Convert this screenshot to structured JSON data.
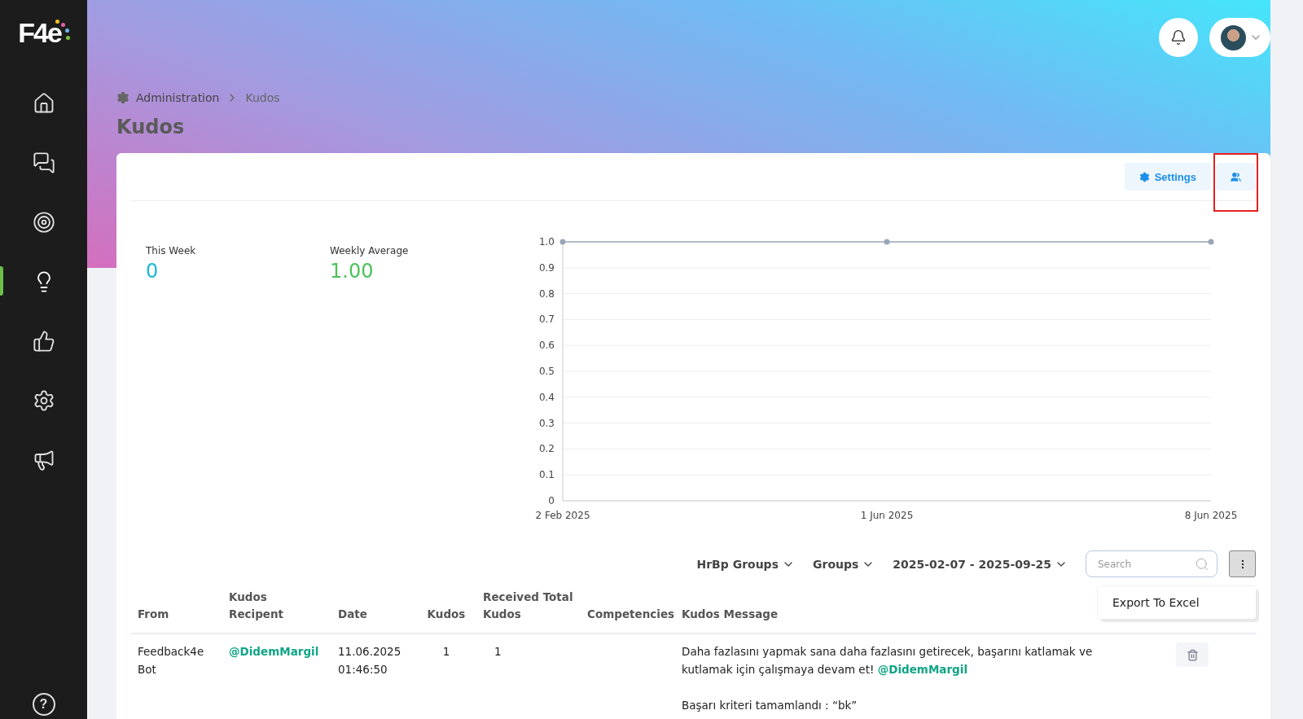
{
  "sidebar": {
    "logo": "F4e",
    "items": [
      {
        "kind": "home",
        "selected": false
      },
      {
        "kind": "chat",
        "selected": false
      },
      {
        "kind": "target",
        "selected": false
      },
      {
        "kind": "idea",
        "selected": true
      },
      {
        "kind": "thumb",
        "selected": false
      },
      {
        "kind": "gear",
        "selected": false
      },
      {
        "kind": "megaphone",
        "selected": false
      }
    ],
    "help": "?"
  },
  "header": {
    "breadcrumb": [
      "Administration",
      "Kudos"
    ],
    "title": "Kudos"
  },
  "toolbar": {
    "buttons": [
      {
        "kind": "settings",
        "label": "Settings"
      },
      {
        "kind": "groups",
        "highlighted": true
      }
    ]
  },
  "stats": [
    {
      "label": "This Week",
      "value": "0",
      "color": "#1ab8d6"
    },
    {
      "label": "Weekly Average",
      "value": "1.00",
      "color": "#4cc25a"
    }
  ],
  "chart_data": {
    "type": "line",
    "grid": true,
    "categories": [
      "2 Feb 2025",
      "1 Jun 2025",
      "8 Jun 2025"
    ],
    "series": [
      {
        "color": "#9aa6b8",
        "marker": true,
        "values": [
          1,
          1,
          1
        ]
      }
    ],
    "ylim": [
      0,
      1
    ],
    "yticks": [
      {
        "value": 0,
        "label": "0"
      },
      {
        "value": 0.1,
        "label": "0.1"
      },
      {
        "value": 0.2,
        "label": "0.2"
      },
      {
        "value": 0.3,
        "label": "0.3"
      },
      {
        "value": 0.4,
        "label": "0.4"
      },
      {
        "value": 0.5,
        "label": "0.5"
      },
      {
        "value": 0.6,
        "label": "0.6"
      },
      {
        "value": 0.7,
        "label": "0.7"
      },
      {
        "value": 0.8,
        "label": "0.8"
      },
      {
        "value": 0.9,
        "label": "0.9"
      },
      {
        "value": 1,
        "label": "1.0"
      }
    ]
  },
  "filters": {
    "dropdowns": [
      "HrBp Groups",
      "Groups",
      "2025-02-07 - 2025-09-25"
    ],
    "search": {
      "placeholder": "Search"
    },
    "menu": {
      "open": true,
      "items": [
        "Export To Excel"
      ]
    }
  },
  "table": {
    "columns": [
      "From",
      "Kudos Recipent",
      "Date",
      "Kudos",
      "Received Total Kudos",
      "Competencies",
      "Kudos Message"
    ],
    "rows": [
      {
        "from": "Feedback4e Bot",
        "recipient": "@DidemMargil",
        "date": "11.06.2025 01:46:50",
        "kudos": "1",
        "received_total": "1",
        "message": "Daha fazlasını yapmak sana daha fazlasını getirecek, başarını katlamak ve kutlamak için çalışmaya devam et!",
        "mention": "@DidemMargil",
        "note": "Başarı kriteri tamamlandı : “bk”"
      }
    ]
  }
}
